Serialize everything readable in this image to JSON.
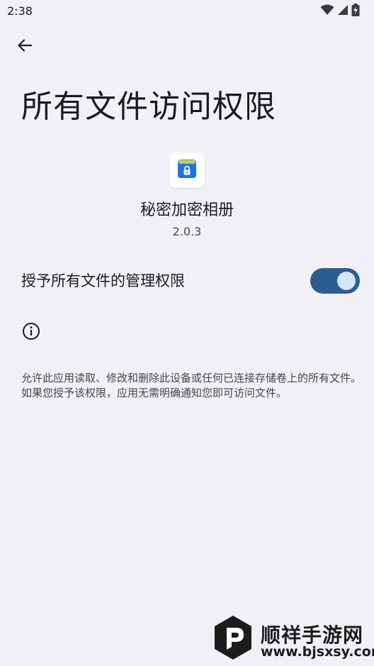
{
  "status_bar": {
    "time": "2:38",
    "icons": [
      "wifi-icon",
      "signal-icon",
      "battery-charging-icon"
    ]
  },
  "header": {
    "back_icon": "arrow-left-icon",
    "title": "所有文件访问权限"
  },
  "app": {
    "icon": "locked-album-icon",
    "name": "秘密加密相册",
    "version": "2.0.3"
  },
  "permission": {
    "label": "授予所有文件的管理权限",
    "enabled": true,
    "accent_color": "#2b5d92"
  },
  "info": {
    "icon": "info-icon",
    "description": "允许此应用读取、修改和删除此设备或任何已连接存储卷上的所有文件。如果您授予该权限，应用无需明确通知您即可访问文件。"
  },
  "watermark": {
    "name": "顺祥手游网",
    "url": "www.bjsxsy.com"
  }
}
